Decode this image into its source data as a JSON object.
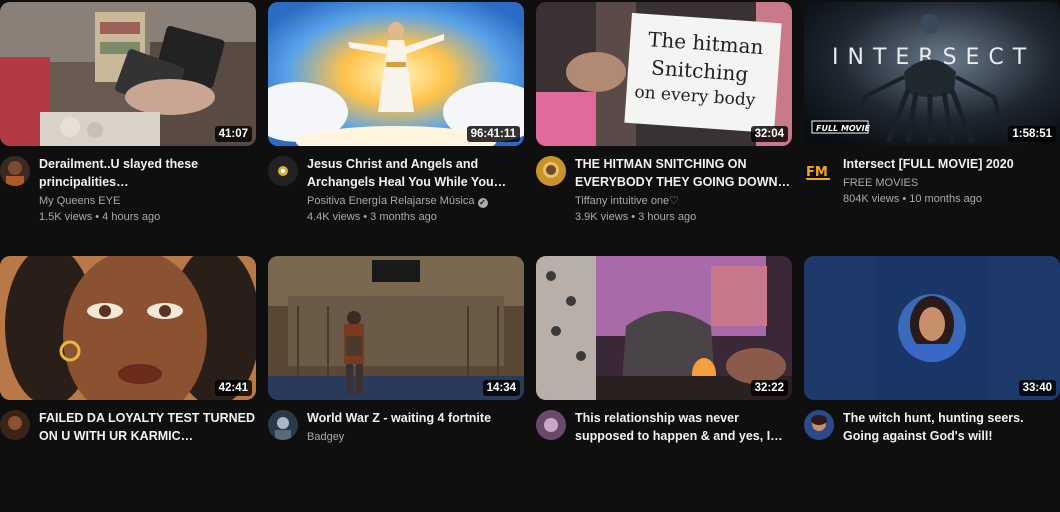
{
  "videos": [
    {
      "title": "Derailment..U slayed these principalities…",
      "channel": "My Queens EYE",
      "views": "1.5K views",
      "age": "4 hours ago",
      "duration": "41:07",
      "verified": false
    },
    {
      "title": "Jesus Christ and Angels and Archangels Heal You While You…",
      "channel": "Positiva Energía Relajarse Música",
      "views": "4.4K views",
      "age": "3 months ago",
      "duration": "96:41:11",
      "verified": true
    },
    {
      "title": "THE HITMAN SNITCHING ON EVERYBODY THEY GOING DOWN…",
      "channel": "Tiffany intuitive one♡",
      "views": "3.9K views",
      "age": "3 hours ago",
      "duration": "32:04",
      "verified": false
    },
    {
      "title": "Intersect [FULL MOVIE] 2020",
      "channel": "FREE MOVIES",
      "views": "804K views",
      "age": "10 months ago",
      "duration": "1:58:51",
      "verified": false
    },
    {
      "title": "FAILED DA LOYALTY TEST TURNED ON U WITH UR KARMIC…",
      "channel": "",
      "views": "",
      "age": "",
      "duration": "42:41",
      "verified": false
    },
    {
      "title": "World War Z - waiting 4 fortnite",
      "channel": "Badgey",
      "views": "",
      "age": "",
      "duration": "14:34",
      "verified": false
    },
    {
      "title": "This relationship was never supposed to happen & and yes, I…",
      "channel": "",
      "views": "",
      "age": "",
      "duration": "32:22",
      "verified": false
    },
    {
      "title": "The witch hunt, hunting seers. Going against God's will!",
      "channel": "",
      "views": "",
      "age": "",
      "duration": "33:40",
      "verified": false
    }
  ],
  "thumb_text": {
    "note_line1": "The hitman",
    "note_line2": "Snitching",
    "note_line3": "on every body",
    "movie_title": "INTERSECT",
    "movie_badge": "FULL MOVIE",
    "channel_logo": "FM"
  },
  "colors": {
    "background": "#0f0f0f",
    "title": "#f1f1f1",
    "secondary": "#aaaaaa"
  }
}
